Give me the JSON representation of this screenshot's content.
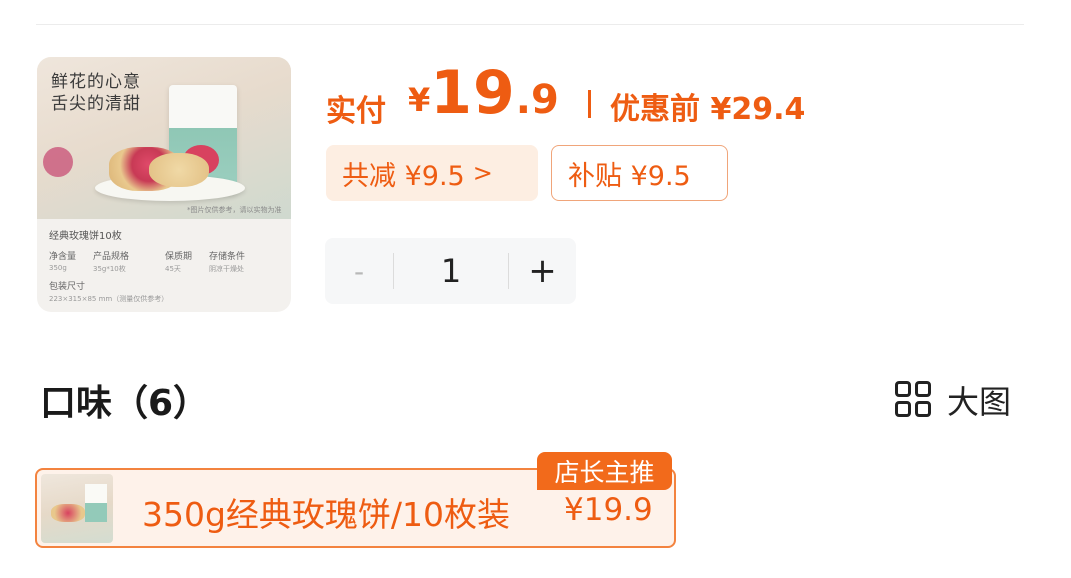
{
  "product": {
    "thumbnail": {
      "slogan_line1": "鲜花的心意",
      "slogan_line2": "舌尖的清甜",
      "caption": "*图片仅供参考，请以实物为准",
      "info_title": "经典玫瑰饼10枚",
      "specs": [
        {
          "label": "净含量",
          "value": "350g"
        },
        {
          "label": "产品规格",
          "value": "35g*10枚"
        },
        {
          "label": "保质期",
          "value": "45天"
        },
        {
          "label": "存储条件",
          "value": "阴凉干燥处"
        }
      ],
      "package_label": "包装尺寸",
      "package_value": "223×315×85 mm（测量仅供参考）"
    }
  },
  "price": {
    "label": "实付",
    "currency": "¥",
    "integer": "19",
    "decimal": ".9",
    "original_label": "优惠前 ¥29.4"
  },
  "chips": {
    "discount": "共减 ¥9.5",
    "discount_arrow": ">",
    "subsidy": "补贴 ¥9.5"
  },
  "stepper": {
    "minus": "-",
    "quantity": "1",
    "plus": "+"
  },
  "flavor": {
    "title": "口味（6）",
    "view_toggle_label": "大图",
    "options": [
      {
        "badge": "店长主推",
        "name": "350g经典玫瑰饼/10枚装",
        "price": "¥19.9"
      }
    ]
  },
  "colors": {
    "accent": "#ee5c12",
    "badge_bg": "#f26a1b",
    "chip_bg": "#fdeee2",
    "selected_border": "#f3833f",
    "selected_bg": "#fef2ea",
    "stepper_bg": "#f6f7f8"
  },
  "icons": {
    "view_toggle": "grid-icon",
    "discount_detail": "chevron-right-icon"
  }
}
